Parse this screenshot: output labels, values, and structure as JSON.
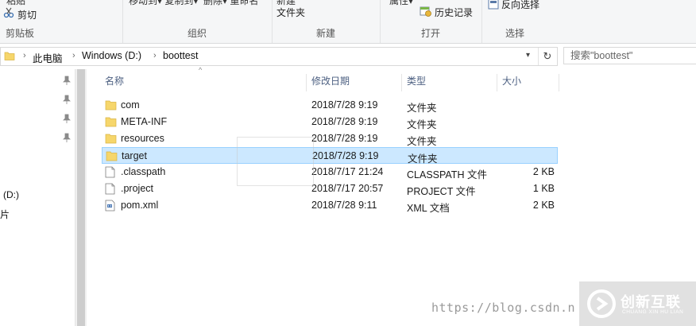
{
  "ribbon": {
    "clipboard": {
      "cut_label": "剪切",
      "group_label": "剪贴板"
    },
    "organize": {
      "group_label": "组织"
    },
    "new": {
      "item_label": "文件夹",
      "group_label": "新建"
    },
    "open": {
      "history_label": "历史记录",
      "group_label": "打开"
    },
    "select": {
      "invert_label": "反向选择",
      "group_label": "选择"
    }
  },
  "address": {
    "breadcrumbs": [
      "此电脑",
      "Windows (D:)",
      "boottest"
    ]
  },
  "search": {
    "placeholder": "搜索\"boottest\""
  },
  "nav": {
    "items": [
      "(D:)"
    ]
  },
  "columns": [
    "名称",
    "修改日期",
    "类型",
    "大小"
  ],
  "files": [
    {
      "name": "com",
      "date": "2018/7/28 9:19",
      "type": "文件夹",
      "size": "",
      "icon": "folder-icon"
    },
    {
      "name": "META-INF",
      "date": "2018/7/28 9:19",
      "type": "文件夹",
      "size": "",
      "icon": "folder-icon"
    },
    {
      "name": "resources",
      "date": "2018/7/28 9:19",
      "type": "文件夹",
      "size": "",
      "icon": "folder-icon"
    },
    {
      "name": "target",
      "date": "2018/7/28 9:19",
      "type": "文件夹",
      "size": "",
      "icon": "folder-icon",
      "selected": true
    },
    {
      "name": ".classpath",
      "date": "2018/7/17 21:24",
      "type": "CLASSPATH 文件",
      "size": "2 KB",
      "icon": "file-icon"
    },
    {
      "name": ".project",
      "date": "2018/7/17 20:57",
      "type": "PROJECT 文件",
      "size": "1 KB",
      "icon": "file-icon"
    },
    {
      "name": "pom.xml",
      "date": "2018/7/28 9:11",
      "type": "XML 文档",
      "size": "2 KB",
      "icon": "xml-file-icon"
    }
  ],
  "watermark": {
    "url": "https://blog.csdn.n",
    "brand_cn": "创新互联",
    "brand_en": "CHUANG XIN HU LIAN"
  },
  "colors": {
    "folder": "#f6d66b",
    "selection": "#cce8ff",
    "selection_border": "#99d1ff",
    "header_text": "#4d6082"
  }
}
